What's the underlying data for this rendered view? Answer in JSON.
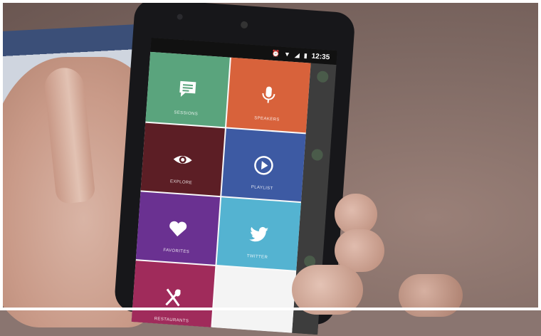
{
  "status_bar": {
    "time": "12:35",
    "icons": [
      "alarm-icon",
      "wifi-icon",
      "signal-icon",
      "battery-icon"
    ]
  },
  "menu": {
    "tiles": [
      {
        "label": "SESSIONS",
        "icon": "chat-list-icon",
        "color": "#5aa47d"
      },
      {
        "label": "SPEAKERS",
        "icon": "microphone-icon",
        "color": "#d8623b"
      },
      {
        "label": "EXPLORE",
        "icon": "eye-icon",
        "color": "#5c1e25"
      },
      {
        "label": "PLAYLIST",
        "icon": "play-circle-icon",
        "color": "#3d5aa3"
      },
      {
        "label": "FAVORITES",
        "icon": "heart-icon",
        "color": "#6a3191"
      },
      {
        "label": "TWITTER",
        "icon": "twitter-bird-icon",
        "color": "#54b3d1"
      },
      {
        "label": "RESTAURANTS",
        "icon": "fork-spoon-icon",
        "color": "#a02b5b"
      }
    ]
  }
}
